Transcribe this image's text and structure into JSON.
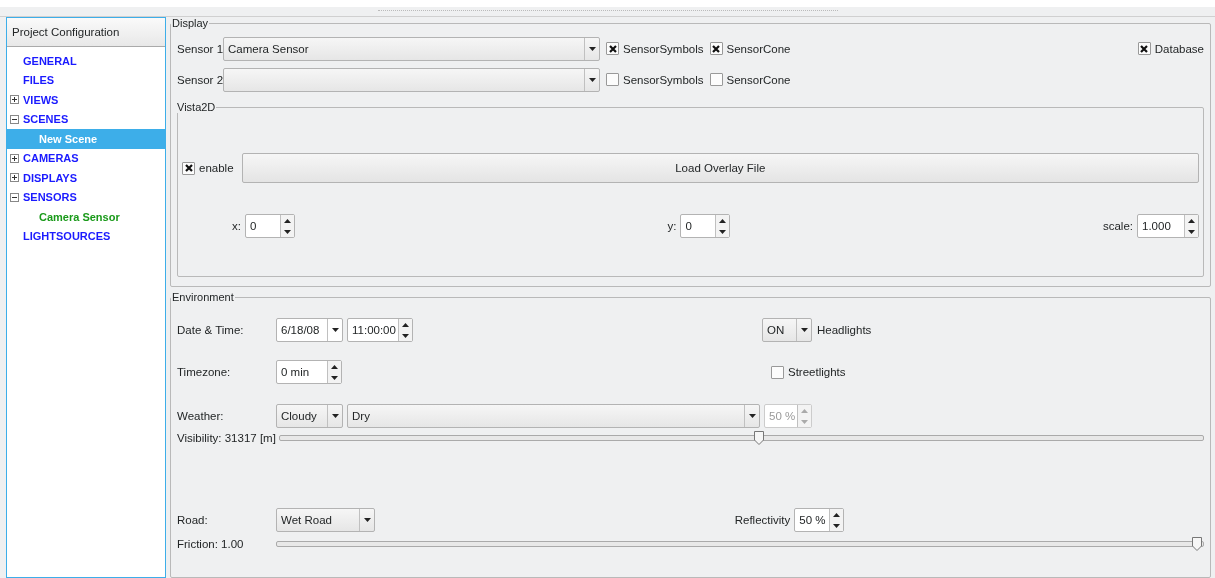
{
  "sidebar": {
    "header": "Project Configuration",
    "items": [
      {
        "label": "GENERAL",
        "selected": false,
        "color": "#1a1aff"
      },
      {
        "label": "FILES",
        "selected": false,
        "color": "#1a1aff"
      },
      {
        "label": "VIEWS",
        "selected": false,
        "expanded": false,
        "color": "#1a1aff"
      },
      {
        "label": "SCENES",
        "selected": false,
        "expanded": true,
        "color": "#1a1aff",
        "children": [
          {
            "label": "New Scene",
            "selected": true
          }
        ]
      },
      {
        "label": "CAMERAS",
        "selected": false,
        "expanded": false,
        "color": "#1a1aff"
      },
      {
        "label": "DISPLAYS",
        "selected": false,
        "expanded": false,
        "color": "#1a1aff"
      },
      {
        "label": "SENSORS",
        "selected": false,
        "expanded": true,
        "color": "#1a1aff",
        "children": [
          {
            "label": "Camera Sensor",
            "selected": false,
            "color": "#1a9a1a"
          }
        ]
      },
      {
        "label": "LIGHTSOURCES",
        "selected": false,
        "color": "#1a1aff"
      }
    ]
  },
  "display": {
    "title": "Display",
    "sensors": [
      {
        "label": "Sensor 1",
        "value": "Camera Sensor",
        "symbols": {
          "label": "SensorSymbols",
          "checked": true
        },
        "cone": {
          "label": "SensorCone",
          "checked": true
        }
      },
      {
        "label": "Sensor 2",
        "symbols": {
          "label": "SensorSymbols",
          "checked": false
        },
        "cone": {
          "label": "SensorCone",
          "checked": false
        }
      }
    ],
    "database": {
      "label": "Database",
      "checked": true
    },
    "vista2d": {
      "title": "Vista2D",
      "enable": {
        "label": "enable",
        "checked": true
      },
      "load_button": "Load Overlay File",
      "x": {
        "label": "x:",
        "value": "0"
      },
      "y": {
        "label": "y:",
        "value": "0"
      },
      "scale": {
        "label": "scale:",
        "value": "1.000"
      }
    }
  },
  "environment": {
    "title": "Environment",
    "date_time": {
      "label": "Date & Time:",
      "date": "6/18/08",
      "time": "11:00:00"
    },
    "headlights": {
      "value": "ON",
      "label": "Headlights"
    },
    "timezone": {
      "label": "Timezone:",
      "value": "0 min"
    },
    "streetlights": {
      "label": "Streetlights",
      "checked": false
    },
    "weather": {
      "label": "Weather:",
      "type": "Cloudy",
      "condition": "Dry",
      "percent": "50 %",
      "percent_disabled": true
    },
    "visibility": {
      "label": "Visibility: 31317 [m]",
      "level": 0.52
    },
    "road": {
      "label": "Road:",
      "value": "Wet Road"
    },
    "reflectivity": {
      "label": "Reflectivity",
      "value": "50 %"
    },
    "friction": {
      "label": "Friction: 1.00",
      "level": 1
    }
  }
}
